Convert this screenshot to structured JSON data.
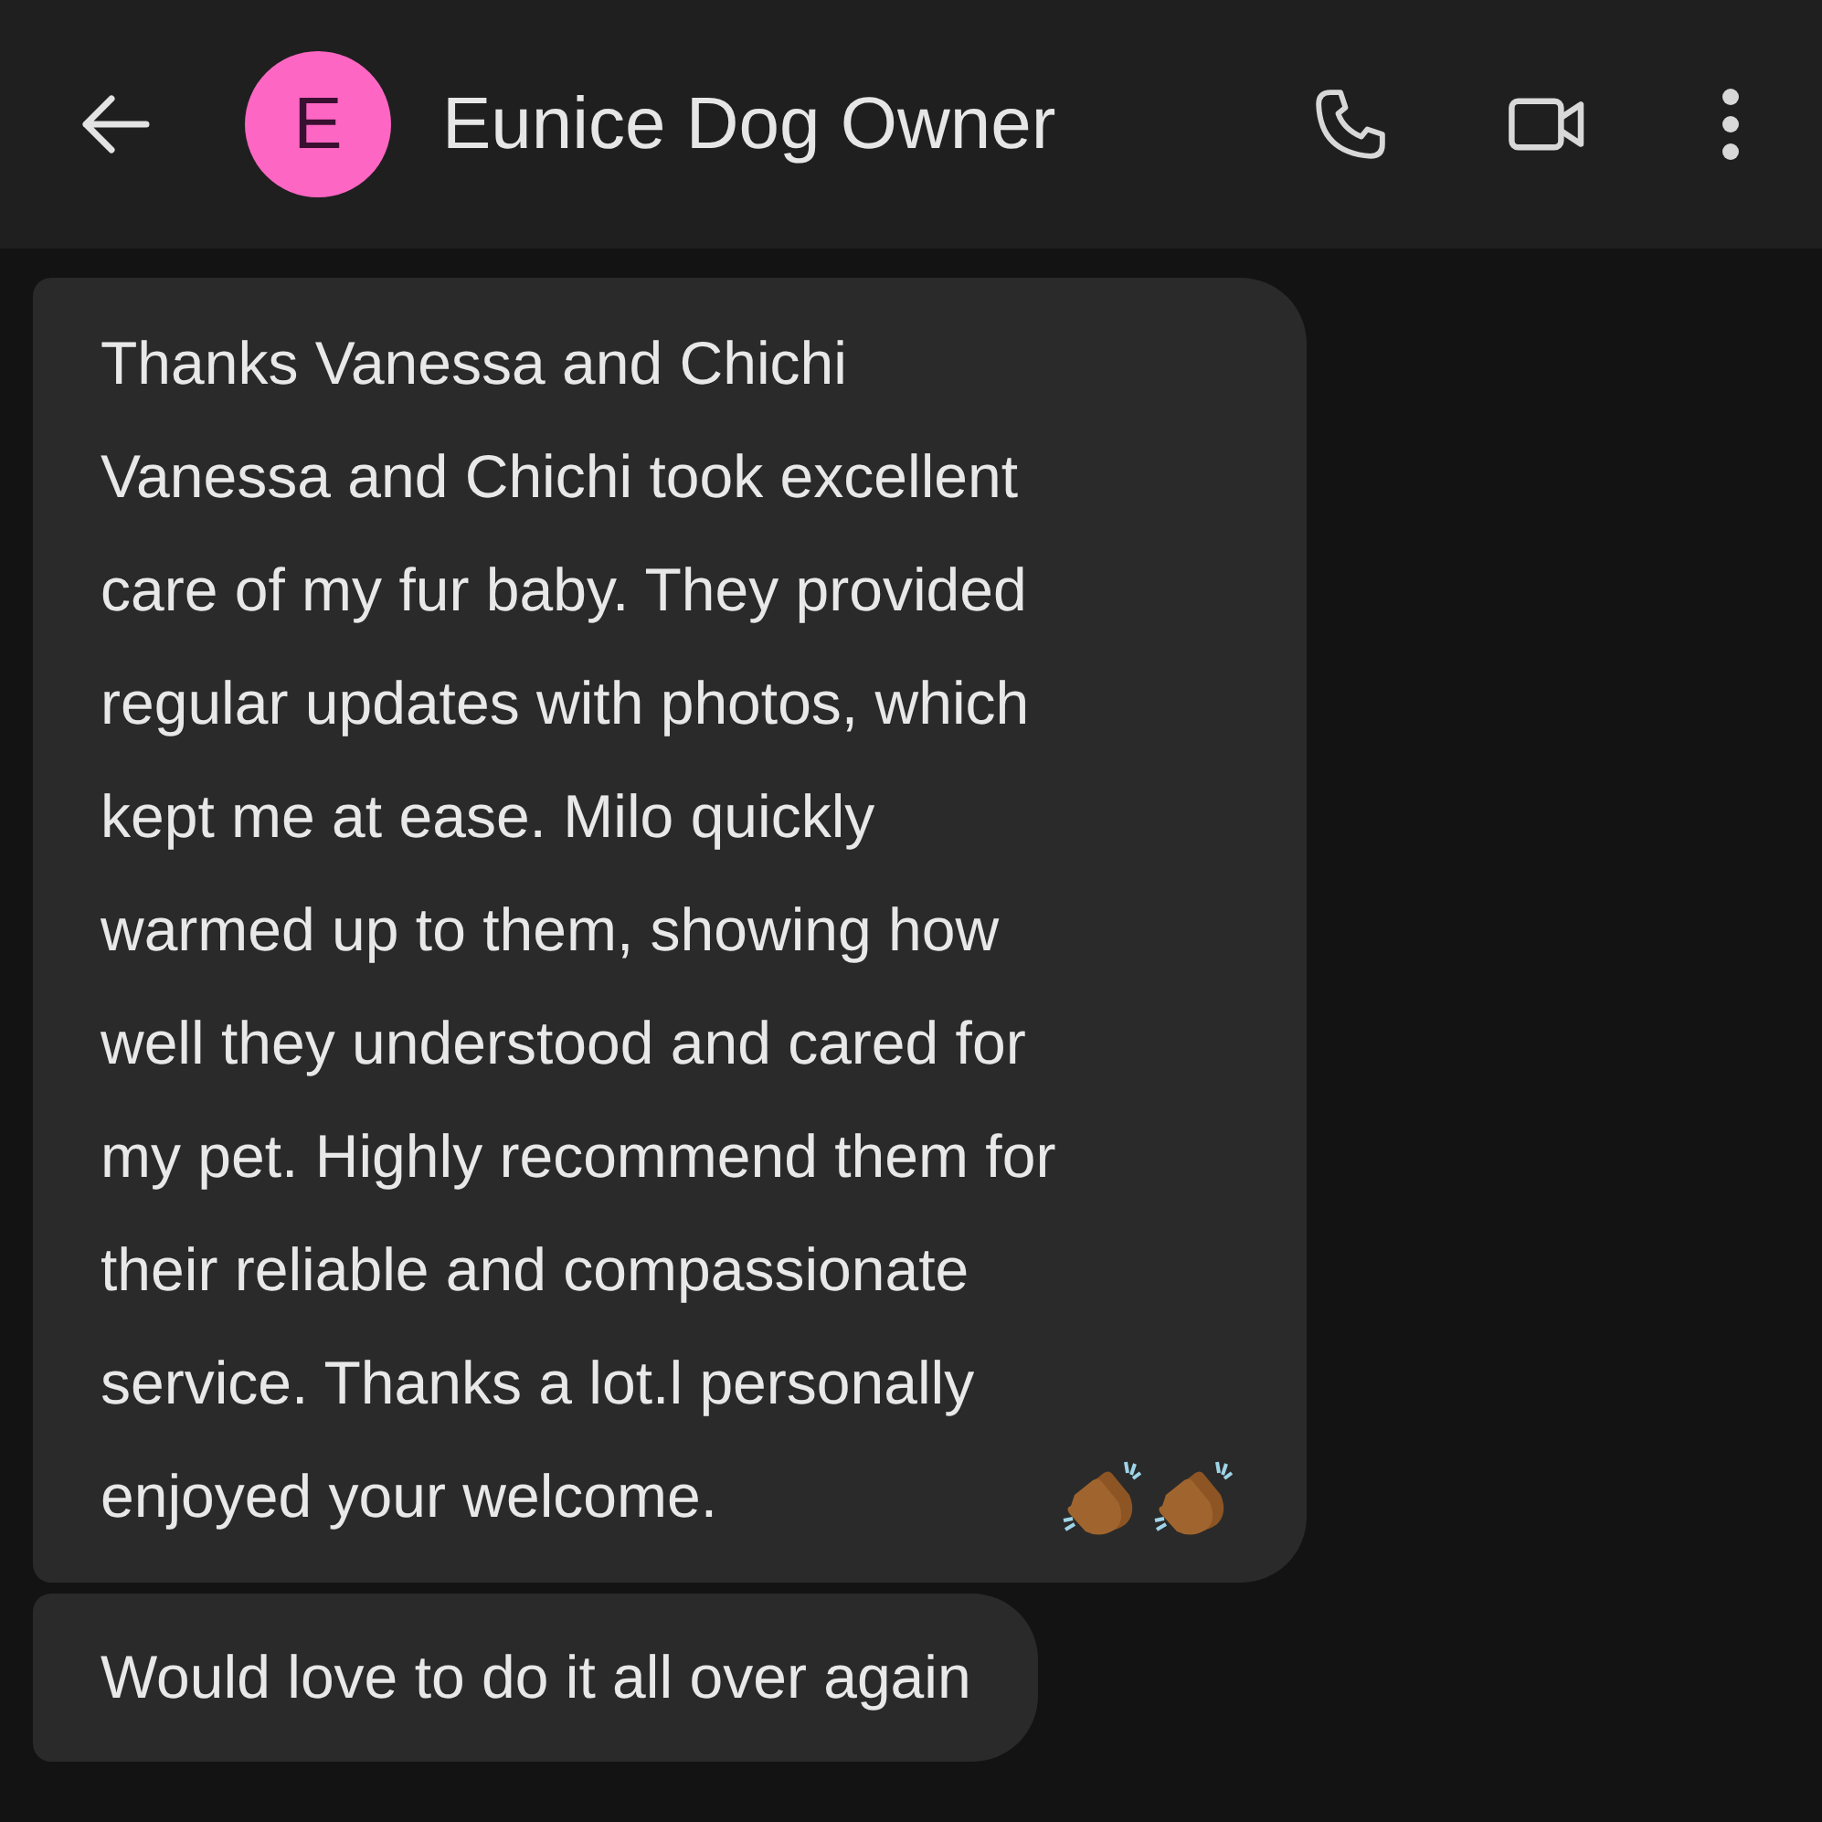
{
  "header": {
    "avatar_letter": "E",
    "title": "Eunice Dog Owner"
  },
  "messages": [
    {
      "text": "Thanks Vanessa and Chichi\nVanessa and Chichi took excellent\ncare of my fur baby. They provided\nregular updates with photos, which\nkept me at ease. Milo quickly\nwarmed up to them, showing how\nwell they understood and cared for\nmy pet. Highly recommend them for\ntheir reliable and compassionate\nservice. Thanks a lot.l personally\nenjoyed your welcome.",
      "reactions": [
        {
          "kind": "clap"
        },
        {
          "kind": "clap"
        }
      ]
    },
    {
      "text": "Would love to do it all over again"
    }
  ]
}
